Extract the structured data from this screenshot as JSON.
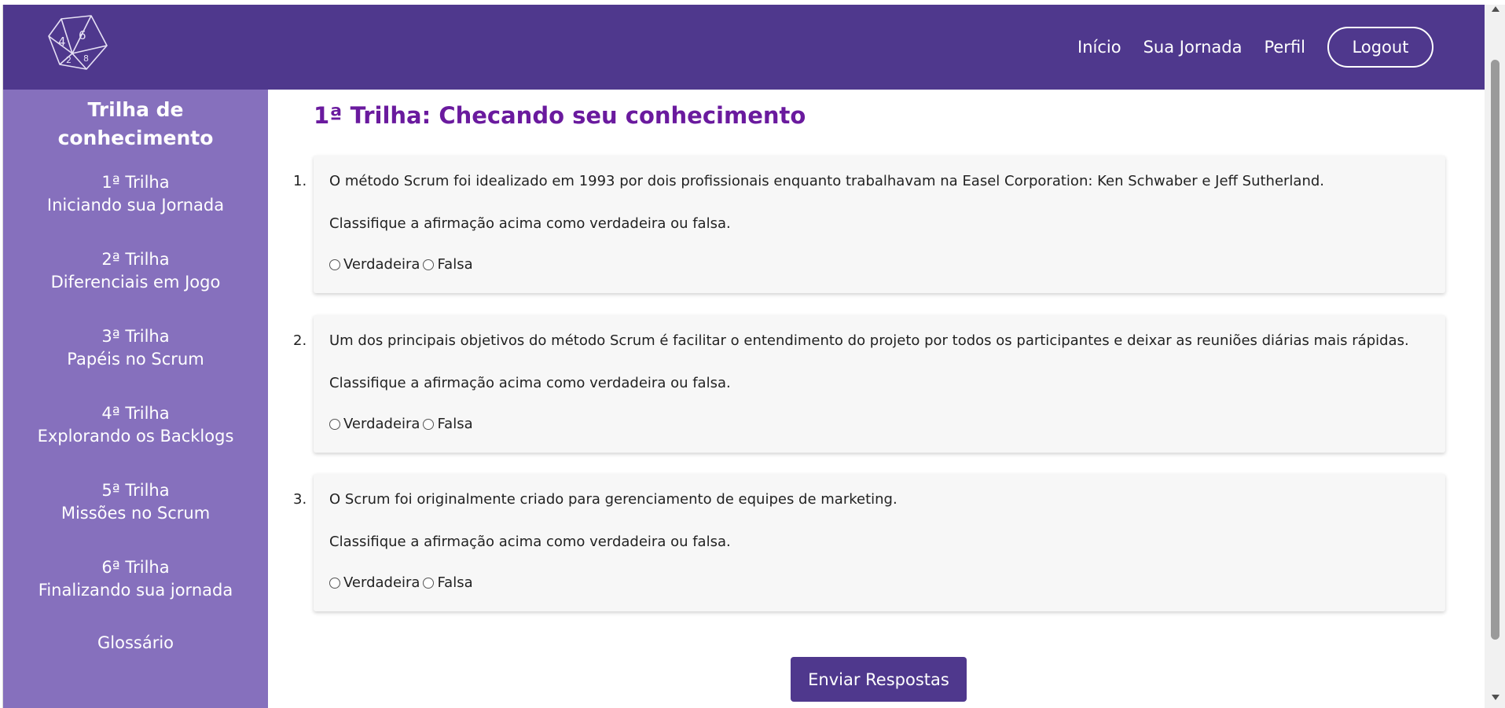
{
  "nav": {
    "links": [
      "Início",
      "Sua Jornada",
      "Perfil"
    ],
    "logout_label": "Logout"
  },
  "logo": {
    "icon": "d10-dice-icon",
    "numbers": [
      "4",
      "6",
      "2",
      "8"
    ]
  },
  "sidebar": {
    "title": "Trilha de conhecimento",
    "items": [
      {
        "line1": "1ª Trilha",
        "line2": "Iniciando sua Jornada"
      },
      {
        "line1": "2ª Trilha",
        "line2": "Diferenciais em Jogo"
      },
      {
        "line1": "3ª Trilha",
        "line2": "Papéis no Scrum"
      },
      {
        "line1": "4ª Trilha",
        "line2": "Explorando os Backlogs"
      },
      {
        "line1": "5ª Trilha",
        "line2": "Missões no Scrum"
      },
      {
        "line1": "6ª Trilha",
        "line2": "Finalizando sua jornada"
      },
      {
        "line1": "Glossário",
        "line2": ""
      }
    ]
  },
  "main": {
    "title": "1ª Trilha: Checando seu conhecimento",
    "questions": [
      {
        "number": "1.",
        "text": "O método Scrum foi idealizado em 1993 por dois profissionais enquanto trabalhavam na Easel Corporation: Ken Schwaber e Jeff Sutherland.",
        "instruction": "Classifique a afirmação acima como verdadeira ou falsa.",
        "option_true": "Verdadeira",
        "option_false": "Falsa"
      },
      {
        "number": "2.",
        "text": "Um dos principais objetivos do método Scrum é facilitar o entendimento do projeto por todos os participantes e deixar as reuniões diárias mais rápidas.",
        "instruction": "Classifique a afirmação acima como verdadeira ou falsa.",
        "option_true": "Verdadeira",
        "option_false": "Falsa"
      },
      {
        "number": "3.",
        "text": "O Scrum foi originalmente criado para gerenciamento de equipes de marketing.",
        "instruction": "Classifique a afirmação acima como verdadeira ou falsa.",
        "option_true": "Verdadeira",
        "option_false": "Falsa"
      }
    ],
    "submit_label": "Enviar Respostas"
  },
  "colors": {
    "header": "#4f388d",
    "sidebar": "#8670bd",
    "title": "#6a1a9e",
    "card": "#f7f7f7"
  }
}
